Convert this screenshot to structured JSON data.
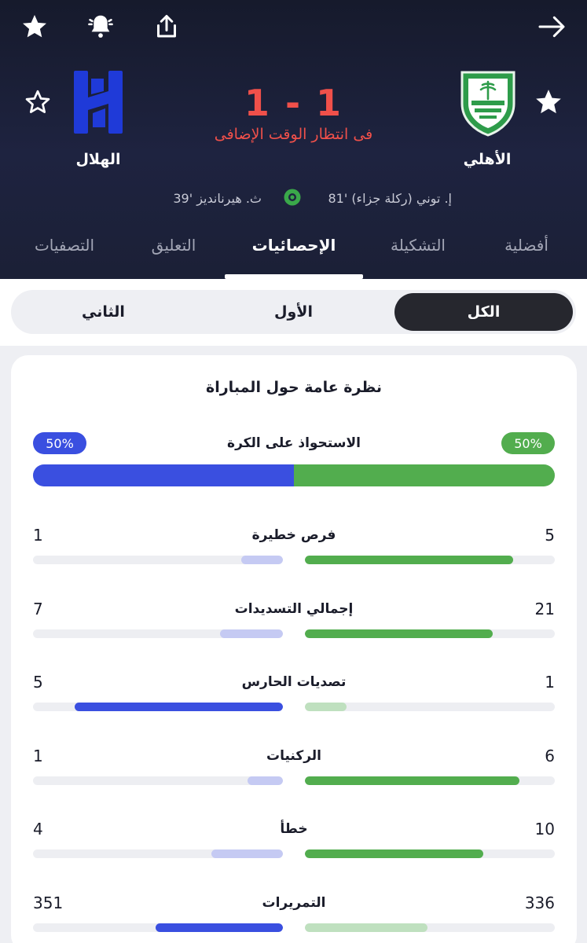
{
  "match": {
    "score": "1 - 1",
    "status": "فى انتظار الوقت الإضافى",
    "home_team": "الأهلي",
    "away_team": "الهلال",
    "home_goal": "إ. توني (ركلة جزاء) '81",
    "away_goal": "ث. هيرنانديز '39"
  },
  "icons": {
    "back": "arrow-right-icon",
    "share": "share-icon",
    "alert": "bell-icon",
    "favorite": "star-icon"
  },
  "tabs": [
    {
      "label": "أفضلية",
      "active": false
    },
    {
      "label": "التشكيلة",
      "active": false
    },
    {
      "label": "الإحصائيات",
      "active": true
    },
    {
      "label": "التعليق",
      "active": false
    },
    {
      "label": "التصفيات",
      "active": false
    }
  ],
  "periods": [
    {
      "label": "الكل",
      "active": true
    },
    {
      "label": "الأول",
      "active": false
    },
    {
      "label": "الثاني",
      "active": false
    }
  ],
  "card": {
    "title": "نظرة عامة حول المباراة",
    "possession": {
      "label": "الاستحواذ على الكرة",
      "home": "50%",
      "away": "50%",
      "home_value": 50,
      "away_value": 50
    },
    "stats": [
      {
        "label": "فرص خطيرة",
        "home": "5",
        "away": "1",
        "home_value": 5,
        "away_value": 1
      },
      {
        "label": "إجمالي التسديدات",
        "home": "21",
        "away": "7",
        "home_value": 21,
        "away_value": 7
      },
      {
        "label": "تصديات الحارس",
        "home": "1",
        "away": "5",
        "home_value": 1,
        "away_value": 5
      },
      {
        "label": "الركنيات",
        "home": "6",
        "away": "1",
        "home_value": 6,
        "away_value": 1
      },
      {
        "label": "خطأ",
        "home": "10",
        "away": "4",
        "home_value": 10,
        "away_value": 4
      },
      {
        "label": "التمريرات",
        "home": "336",
        "away": "351",
        "home_value": 336,
        "away_value": 351
      }
    ]
  },
  "colors": {
    "home": "#52ad4e",
    "home_light": "#bfe0bf",
    "away": "#3a4fe0",
    "away_light": "#c5caf3",
    "score": "#f0504a"
  }
}
